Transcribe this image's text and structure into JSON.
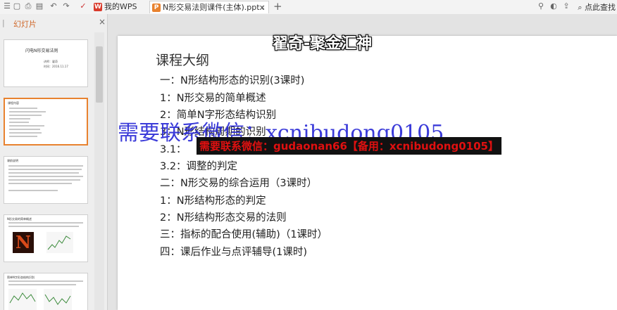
{
  "titlebar": {
    "tabs": [
      {
        "label": "我的WPS",
        "icon": "wps-logo-icon"
      },
      {
        "label": "N形交易法则课件(主体).pptx",
        "icon": "presentation-file-icon"
      }
    ],
    "search_label": "点此查找"
  },
  "left_panel": {
    "title": "幻灯片",
    "thumbnails": [
      {
        "title": "闪电N形交易法则",
        "lines": [
          "讲师：翟奇",
          "时间：2016.11.17"
        ]
      },
      {
        "title": "课程内容"
      },
      {
        "title": "课前说明"
      },
      {
        "title": "N形交易的简单概述"
      },
      {
        "title": "简单N字形态结构识别"
      }
    ]
  },
  "overlay": {
    "banner": "翟奇-聚金汇神",
    "watermark_blue": "需要联系微信：xcnibudong0105",
    "watermark_red": "需要联系微信：gudaonan66【备用：xcnibudong0105】"
  },
  "slide": {
    "heading": "课程大纲",
    "items": [
      "一：N形结构形态的识别(3课时)",
      "1：N形交易的简单概述",
      "2：简单N字形态结构识别",
      "3：N形结构周期的识别",
      "3.1：",
      "3.2：调整的判定",
      "二：N形交易的综合运用（3课时）",
      "1：N形结构形态的判定",
      "2：N形结构形态交易的法则",
      "三：指标的配合使用(辅助)（1课时）",
      "四：课后作业与点评辅导(1课时)"
    ]
  },
  "colors": {
    "accent": "#e8822f",
    "watermark_blue": "#2b2bd6",
    "watermark_red": "#e01010"
  }
}
